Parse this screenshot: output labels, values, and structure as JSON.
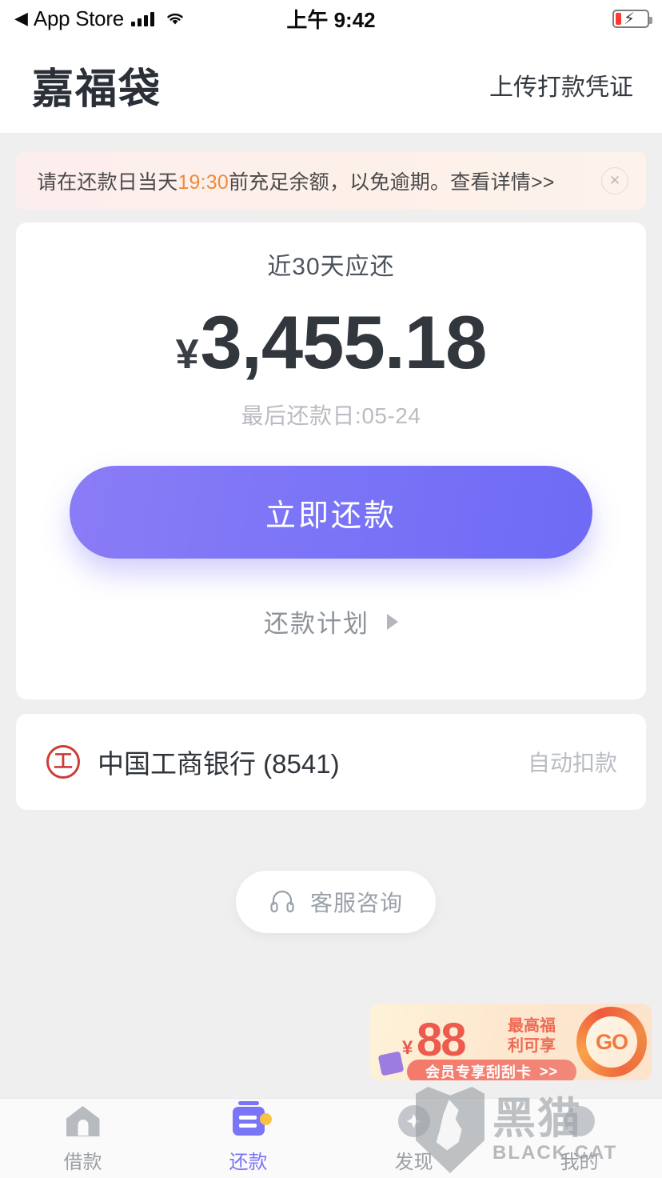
{
  "status_bar": {
    "back_app": "App Store",
    "back_arrow": "◀",
    "time": "上午 9:42",
    "signal_icon": "signal-bars-icon",
    "wifi_icon": "wifi-icon",
    "battery_icon": "battery-charging-icon"
  },
  "header": {
    "title": "嘉福袋",
    "action": "上传打款凭证"
  },
  "notice": {
    "prefix": "请在还款日当天",
    "highlight": "19:30",
    "suffix": "前充足余额，以免逾期。",
    "link": "查看详情>>",
    "close_icon": "close-icon",
    "highlight_color": "#f08b3a"
  },
  "repay_card": {
    "label": "近30天应还",
    "currency": "¥",
    "amount": "3,455.18",
    "due_date": "最后还款日:05-24",
    "pay_button": "立即还款",
    "plan_link": "还款计划",
    "plan_arrow_icon": "chevron-right-icon",
    "button_color": "#7a74f7"
  },
  "bank": {
    "logo_icon": "icbc-logo-icon",
    "logo_glyph": "工",
    "name": "中国工商银行 (8541)",
    "status": "自动扣款",
    "logo_color": "#cf3c38"
  },
  "service": {
    "icon": "headset-icon",
    "label": "客服咨询"
  },
  "promo": {
    "currency": "¥",
    "amount": "88",
    "line1": "最高福",
    "line2": "利可享",
    "pill_text": "会员专享刮刮卡",
    "pill_arrow": ">>",
    "go_label": "GO",
    "envelope_icon": "red-envelope-icon"
  },
  "tabbar": {
    "items": [
      {
        "label": "借款",
        "icon": "home-icon",
        "active": false
      },
      {
        "label": "还款",
        "icon": "repay-card-icon",
        "active": true
      },
      {
        "label": "发现",
        "icon": "compass-icon",
        "active": false
      },
      {
        "label": "我的",
        "icon": "profile-icon",
        "active": false
      }
    ]
  },
  "watermark": {
    "cn": "黑猫",
    "en": "BLACK CAT",
    "logo_icon": "black-cat-shield-icon"
  }
}
